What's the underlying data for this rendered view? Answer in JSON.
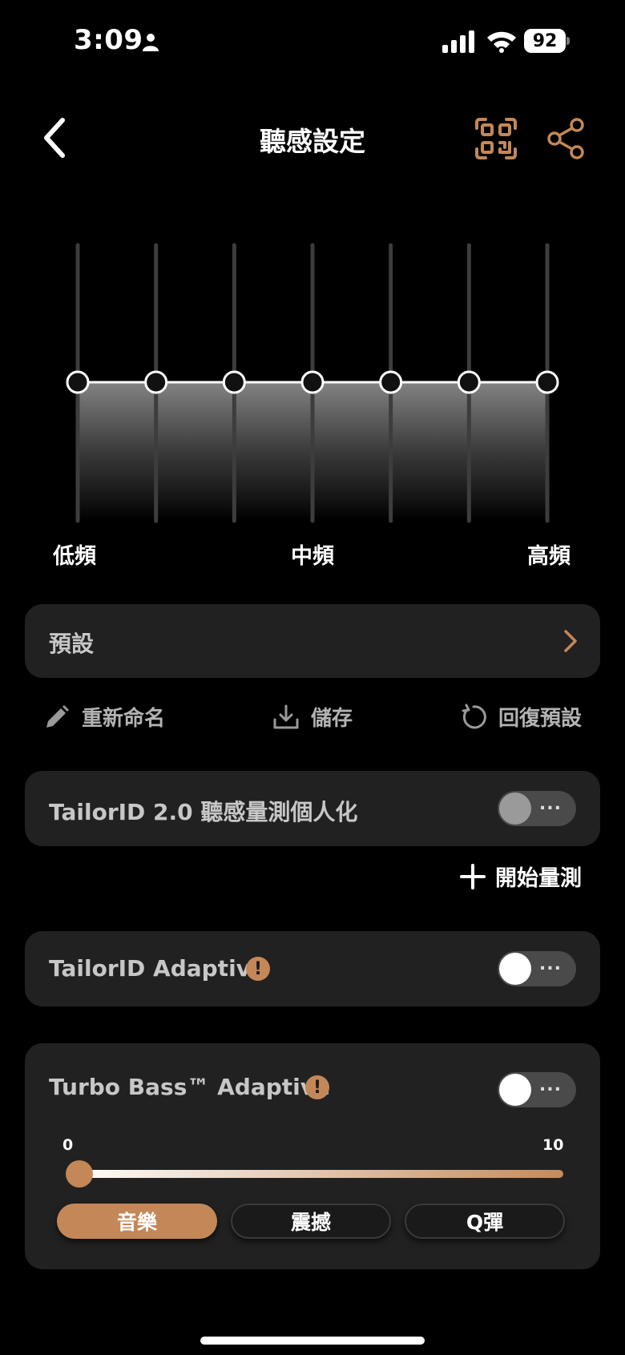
{
  "status": {
    "time": "3:09",
    "battery": "92"
  },
  "header": {
    "title": "聽感設定"
  },
  "eq": {
    "bands": 7,
    "levels": [
      0,
      0,
      0,
      0,
      0,
      0,
      0
    ],
    "labels": {
      "low": "低頻",
      "mid": "中頻",
      "high": "高頻"
    }
  },
  "preset": {
    "label": "預設"
  },
  "actions": {
    "rename": "重新命名",
    "save": "儲存",
    "reset": "回復預設"
  },
  "tailorid2": {
    "label": "TailorID 2.0 聽感量測個人化",
    "toggle_on": false,
    "start_label": "開始量測"
  },
  "tailorid_adaptive": {
    "label": "TailorID Adaptive",
    "toggle_on": false
  },
  "turbo_bass": {
    "label": "Turbo Bass™ Adaptive",
    "toggle_on": false,
    "slider": {
      "min_label": "0",
      "max_label": "10",
      "value": 0
    },
    "modes": [
      "音樂",
      "震撼",
      "Q彈"
    ],
    "selected_mode": "音樂"
  },
  "toggle_dots": "...",
  "colors": {
    "accent": "#c48758",
    "card": "#212121",
    "background": "#000000"
  }
}
